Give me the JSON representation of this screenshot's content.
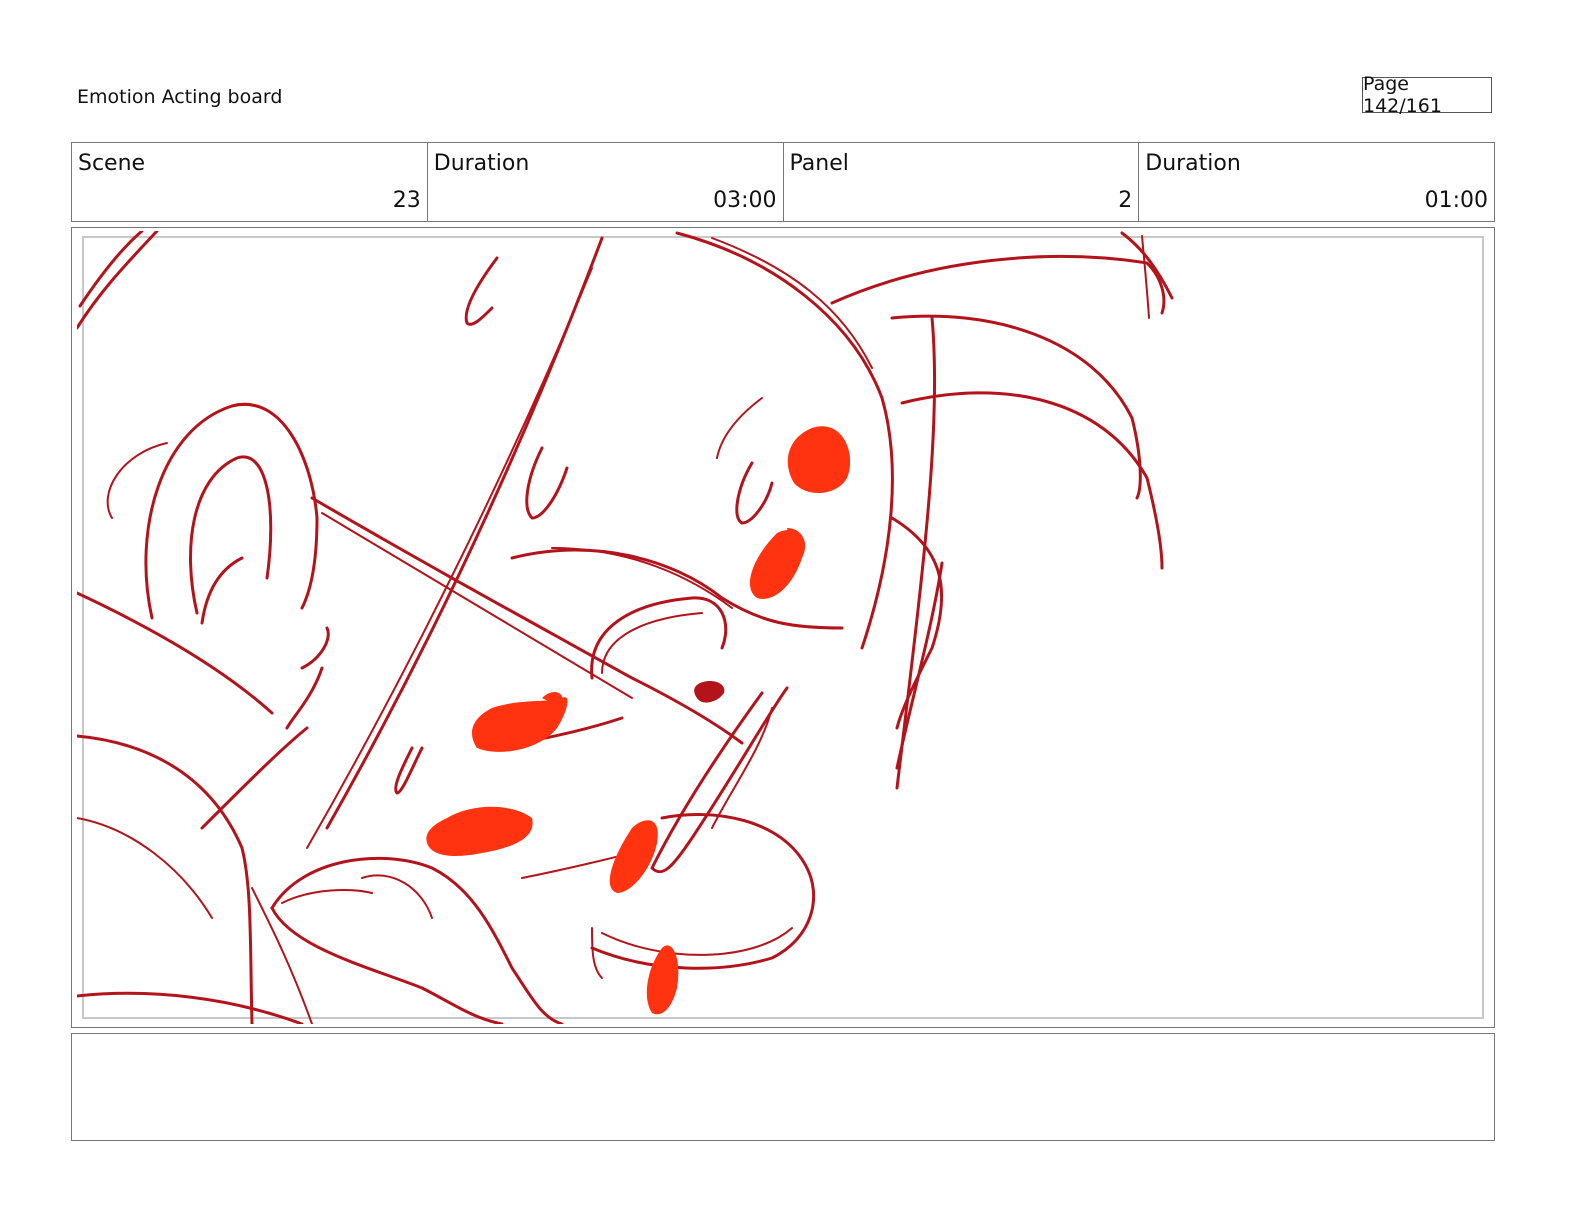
{
  "header": {
    "title": "Emotion Acting board",
    "page": "Page 142/161"
  },
  "info": {
    "scene_label": "Scene",
    "scene_value": "23",
    "scene_duration_label": "Duration",
    "scene_duration_value": "03:00",
    "panel_label": "Panel",
    "panel_value": "2",
    "panel_duration_label": "Duration",
    "panel_duration_value": "01:00"
  },
  "colors": {
    "line": "#b3141b",
    "fill": "#ff3310"
  },
  "notes": ""
}
